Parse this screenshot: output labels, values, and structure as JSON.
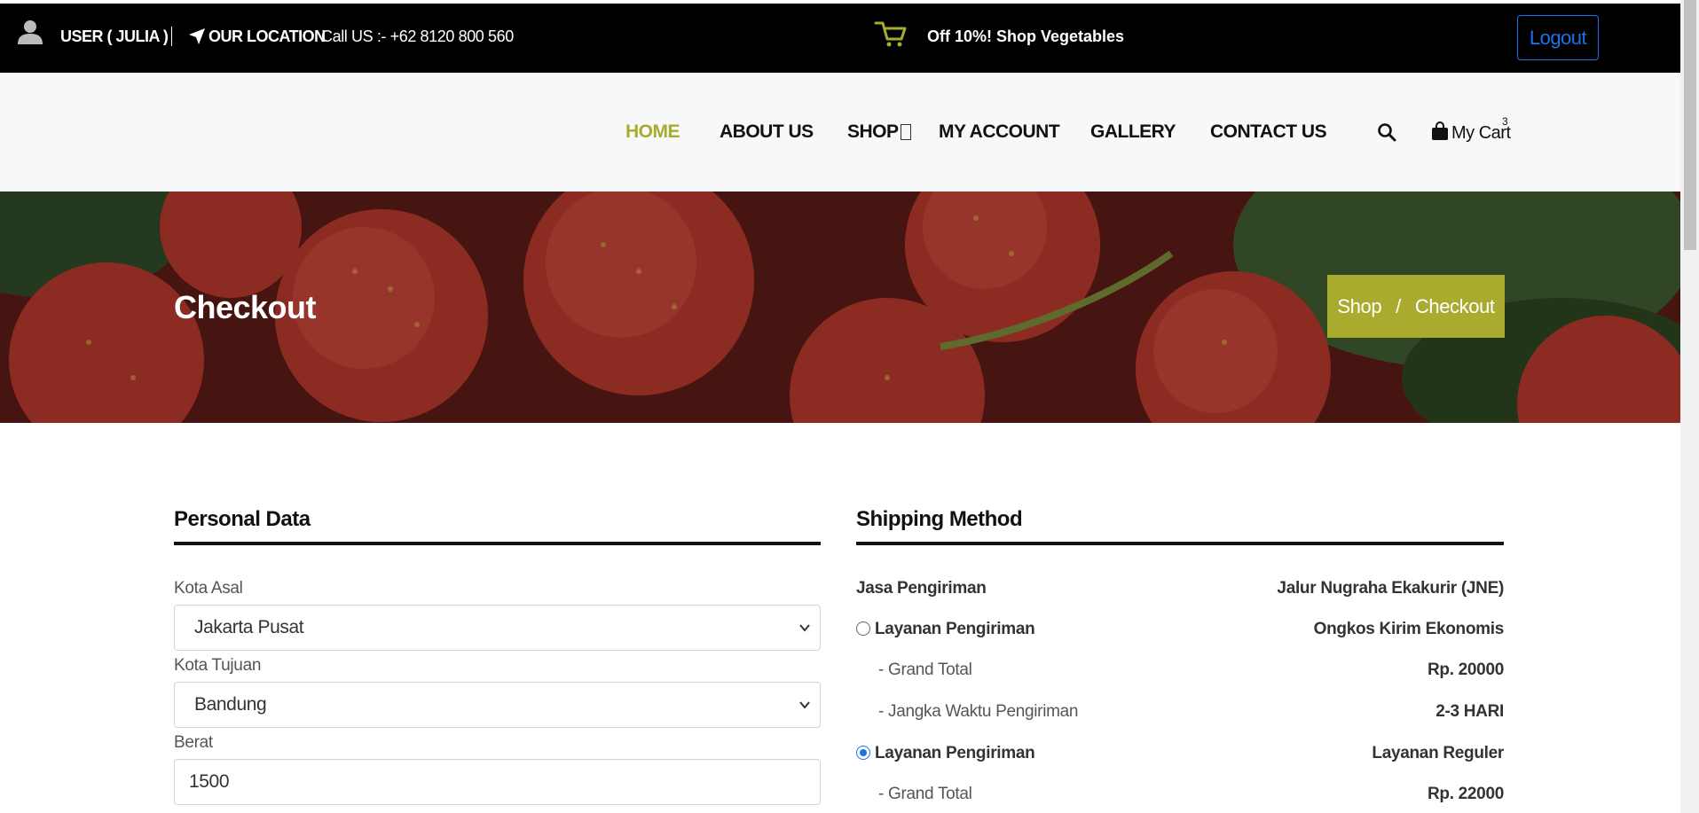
{
  "topbar": {
    "user": "USER ( JULIA )",
    "location": "OUR LOCATION",
    "call": "Call US :- +62 8120 800 560",
    "promo": "Off 10%! Shop Vegetables",
    "logout": "Logout"
  },
  "nav": {
    "items": [
      "HOME",
      "ABOUT US",
      "SHOP",
      "MY ACCOUNT",
      "GALLERY",
      "CONTACT US"
    ],
    "active": "HOME",
    "cart_label": "My Cart",
    "cart_count": "3"
  },
  "banner": {
    "title": "Checkout",
    "breadcrumb": [
      "Shop",
      "Checkout"
    ],
    "breadcrumb_sep": "/"
  },
  "personal": {
    "title": "Personal Data",
    "kota_asal_label": "Kota Asal",
    "kota_asal_value": "Jakarta Pusat",
    "kota_tujuan_label": "Kota Tujuan",
    "kota_tujuan_value": "Bandung",
    "berat_label": "Berat",
    "berat_value": "1500"
  },
  "shipping": {
    "title": "Shipping Method",
    "jasa_label": "Jasa Pengiriman",
    "jasa_value": "Jalur Nugraha Ekakurir (JNE)",
    "options": [
      {
        "label": "Layanan Pengiriman",
        "value": "Ongkos Kirim Ekonomis",
        "selected": false,
        "grand_total_label": "-   Grand Total",
        "grand_total_value": "Rp. 20000",
        "eta_label": "- Jangka Waktu Pengiriman",
        "eta_value": "2-3 HARI"
      },
      {
        "label": "Layanan Pengiriman",
        "value": "Layanan Reguler",
        "selected": true,
        "grand_total_label": "-   Grand Total",
        "grand_total_value": "Rp. 22000"
      }
    ]
  },
  "colors": {
    "accent": "#a9ab2e",
    "topbar_bg": "#000000",
    "link_blue": "#1a73e8"
  }
}
